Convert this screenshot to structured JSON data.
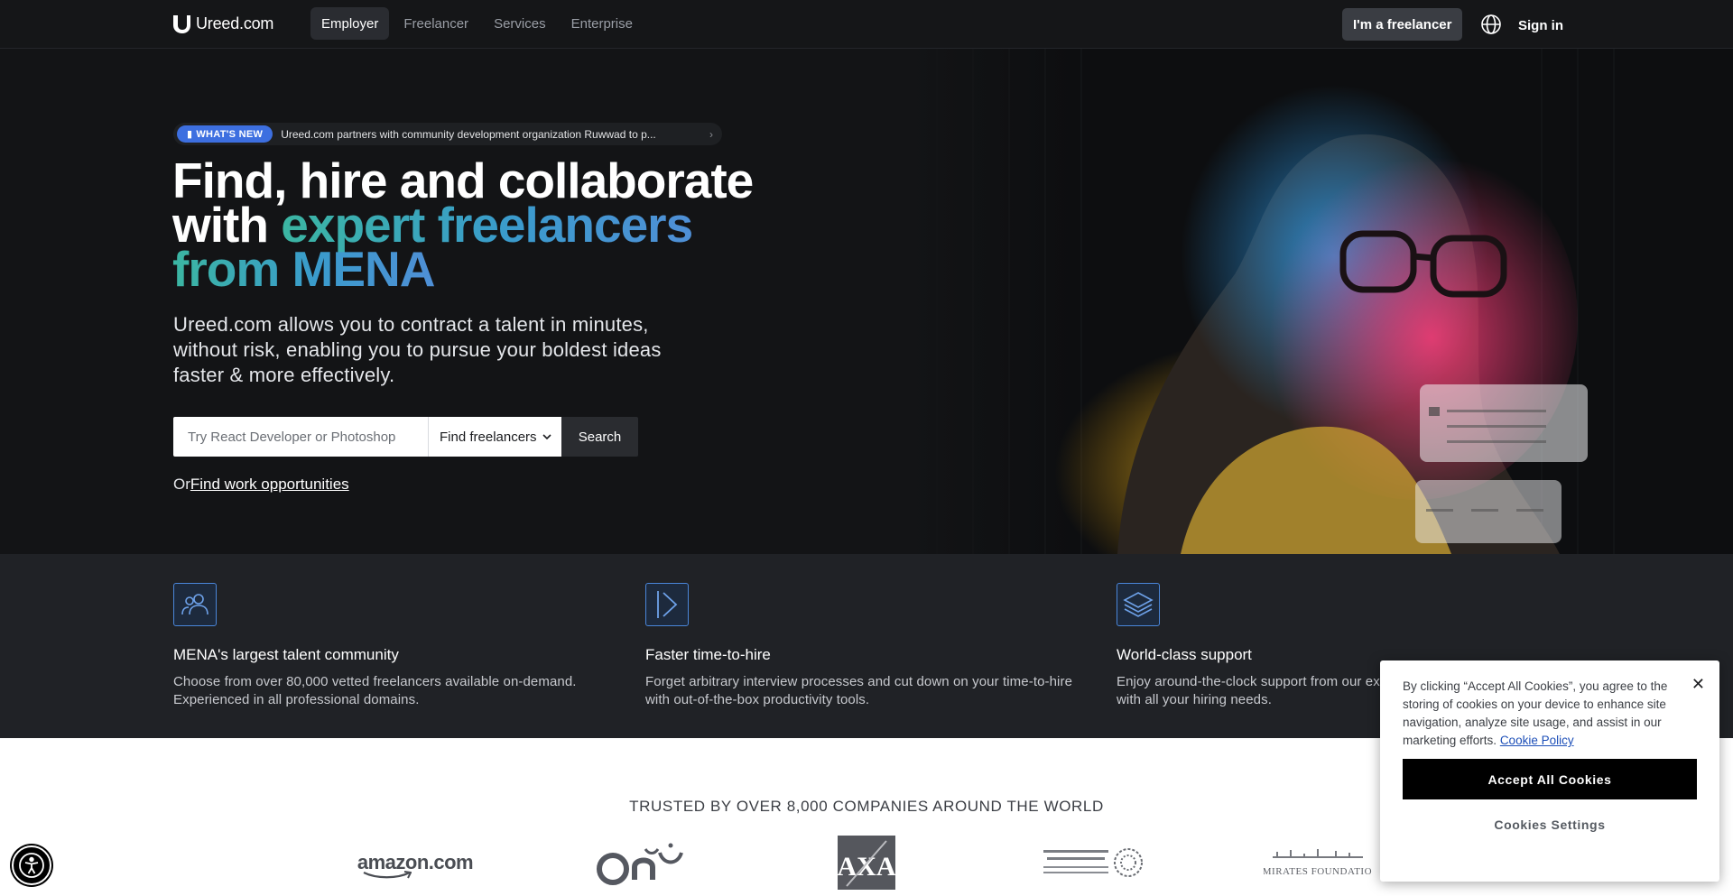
{
  "nav": {
    "logo_text": "Ureed.com",
    "links": [
      {
        "label": "Employer",
        "active": true
      },
      {
        "label": "Freelancer",
        "active": false
      },
      {
        "label": "Services",
        "active": false
      },
      {
        "label": "Enterprise",
        "active": false
      }
    ],
    "freelancer_button": "I'm a freelancer",
    "globe_icon": "globe-icon",
    "signin": "Sign in"
  },
  "hero": {
    "badge": "WHAT'S NEW",
    "announcement": "Ureed.com partners with community development organization Ruwwad to p...",
    "headline_line1": "Find, hire and collaborate",
    "headline_with": "with",
    "headline_gradient_1": "expert freelancers",
    "headline_gradient_2": "from MENA",
    "subtext": "Ureed.com allows you to contract a talent in minutes, without risk, enabling you to pursue your boldest ideas faster & more effectively.",
    "search_placeholder": "Try React Developer or Photoshop",
    "search_select": "Find freelancers",
    "search_button": "Search",
    "or_prefix": "Or",
    "or_link": "Find work opportunities"
  },
  "features": [
    {
      "icon": "users-icon",
      "title": "MENA's largest talent community",
      "desc": "Choose from over 80,000 vetted freelancers available on-demand. Experienced in all professional domains."
    },
    {
      "icon": "fast-forward-icon",
      "title": "Faster time-to-hire",
      "desc": "Forget arbitrary interview processes and cut down on your time-to-hire with out-of-the-box productivity tools."
    },
    {
      "icon": "layers-icon",
      "title": "World-class support",
      "desc": "Enjoy around-the-clock support from our expert team who can help you with all your hiring needs."
    }
  ],
  "trusted": {
    "title": "TRUSTED BY OVER 8,000 COMPANIES AROUND THE WORLD",
    "brands": [
      "amazon.com",
      "noon",
      "AXA",
      "Mohammed Bin Rashid Centre for Government Innovation",
      "Emirates Foundation"
    ]
  },
  "cookie": {
    "text": "By clicking “Accept All Cookies”, you agree to the storing of cookies on your device to enhance site navigation, analyze site usage, and assist in our marketing efforts.",
    "policy_link": "Cookie Policy",
    "accept": "Accept All Cookies",
    "settings": "Cookies Settings"
  },
  "colors": {
    "accent": "#3d6fe0",
    "gradient_start": "#3bb6a2",
    "gradient_end": "#4f8fd6"
  }
}
